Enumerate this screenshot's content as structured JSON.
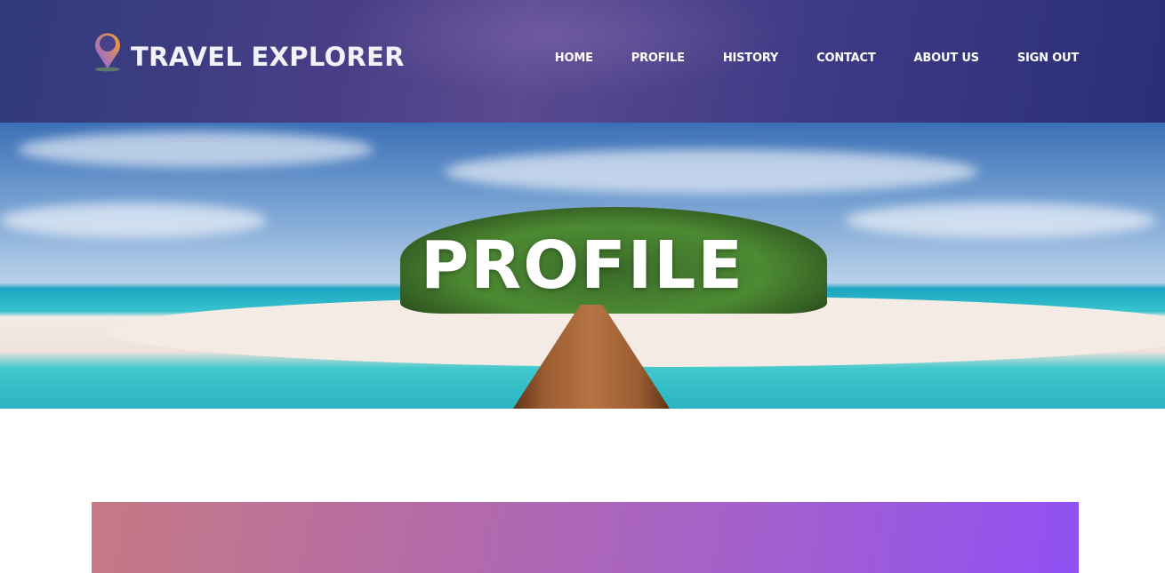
{
  "header": {
    "brand": "TRAVEL EXPLORER",
    "logo_icon": "map-pin-icon",
    "nav": [
      {
        "label": "HOME"
      },
      {
        "label": "PROFILE"
      },
      {
        "label": "HISTORY"
      },
      {
        "label": "CONTACT"
      },
      {
        "label": "ABOUT US"
      },
      {
        "label": "SIGN OUT"
      }
    ]
  },
  "hero": {
    "title": "PROFILE"
  },
  "colors": {
    "gradient_start": "#c57a84",
    "gradient_end": "#9150f4"
  }
}
